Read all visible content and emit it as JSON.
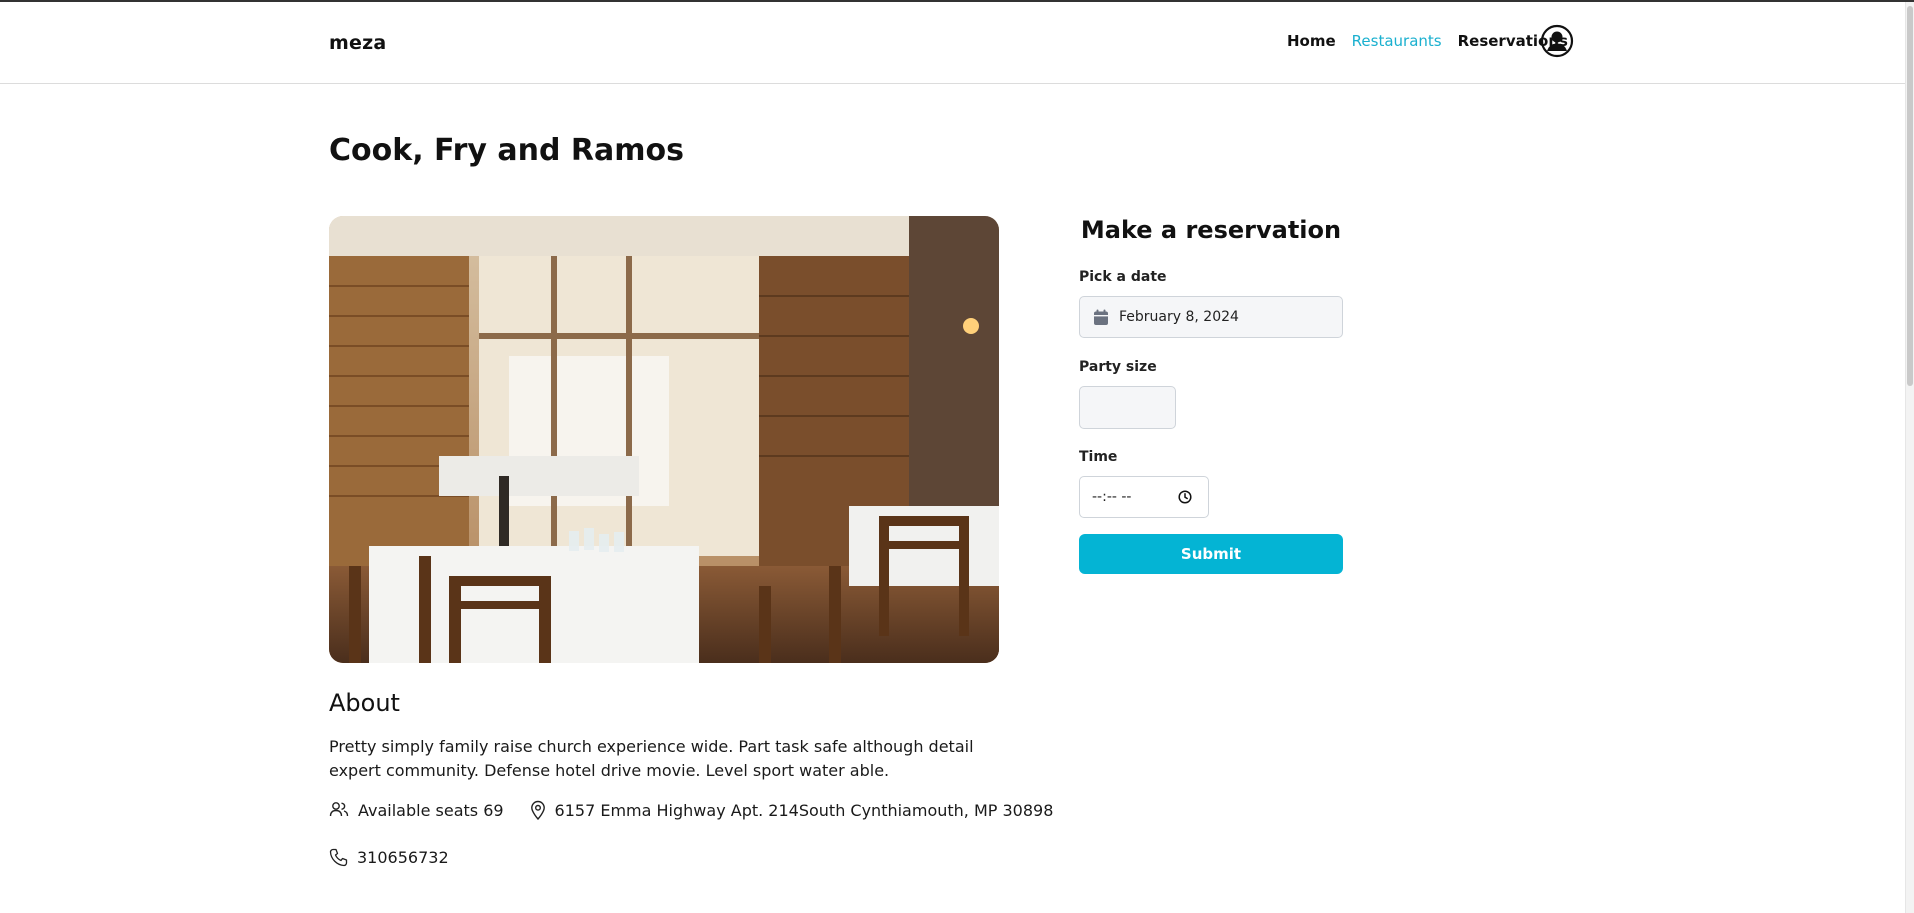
{
  "header": {
    "logo": "meza",
    "nav": [
      {
        "label": "Home",
        "active": false
      },
      {
        "label": "Restaurants",
        "active": true
      },
      {
        "label": "Reservations",
        "active": false
      }
    ],
    "avatar_icon": "user-circle-icon"
  },
  "restaurant": {
    "name": "Cook, Fry and Ramos",
    "photo_alt": "restaurant-interior-photo",
    "about_heading": "About",
    "about_text": "Pretty simply family raise church experience wide. Part task safe although detail expert community. Defense hotel drive movie. Level sport water able.",
    "seats_label": "Available seats 69",
    "address": "6157 Emma Highway Apt. 214South Cynthiamouth, MP 30898",
    "phone": "310656732"
  },
  "reservation": {
    "title": "Make a reservation",
    "date_label": "Pick a date",
    "date_value": "February 8, 2024",
    "party_label": "Party size",
    "party_value": "",
    "time_label": "Time",
    "time_value": "--:-- --",
    "submit_label": "Submit"
  },
  "colors": {
    "accent": "#04b4d4",
    "nav_active": "#1ab0cf"
  }
}
